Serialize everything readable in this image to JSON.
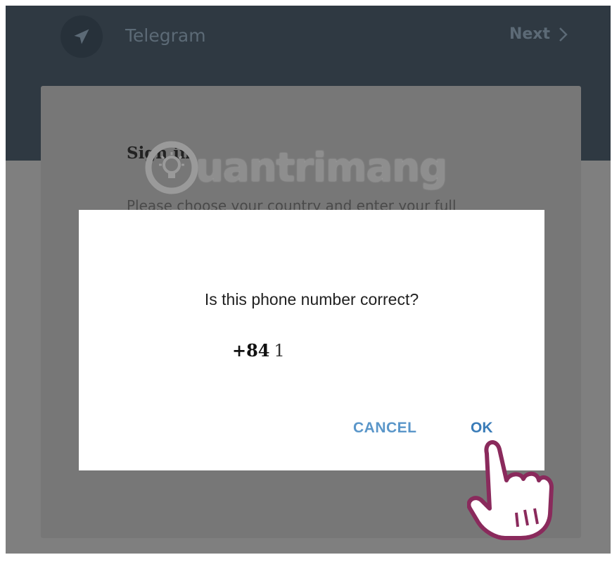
{
  "header": {
    "app_title": "Telegram",
    "next_label": "Next",
    "icons": {
      "logo": "telegram-plane-icon",
      "next": "chevron-right-icon"
    }
  },
  "signin": {
    "title": "Sign in",
    "description": "Please choose your country and enter your full"
  },
  "watermark": {
    "text": "uantrimang"
  },
  "dialog": {
    "question": "Is this phone number correct?",
    "phone_code": "+84",
    "phone_number": "1",
    "cancel_label": "CANCEL",
    "ok_label": "OK"
  },
  "colors": {
    "header_bg": "#2f3942",
    "overlay_bg": "#7f7f7f",
    "button_blue": "#3a7cb8"
  }
}
